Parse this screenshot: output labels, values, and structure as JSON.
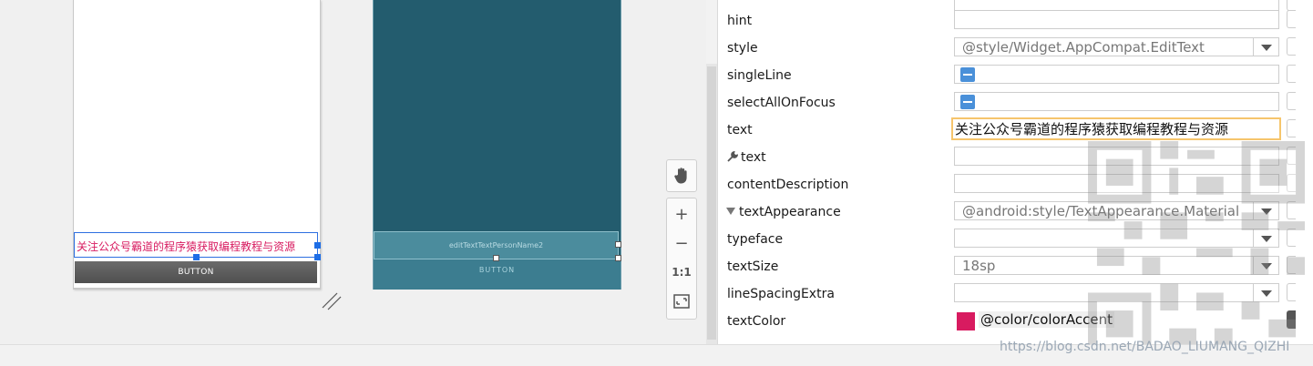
{
  "layout_preview": {
    "edit_text": "关注公众号霸道的程序猿获取编程教程与资源",
    "button_label": "BUTTON"
  },
  "blueprint_preview": {
    "edit_id": "editTextTextPersonName2",
    "button_label": "BUTTON"
  },
  "zoom_toolbar": {
    "pan_icon": "hand-icon",
    "zoom_in": "+",
    "zoom_out": "−",
    "actual_size": "1:1",
    "fit_icon": "fit-screen-icon"
  },
  "attributes": {
    "rows": [
      {
        "name": "hint",
        "value": "",
        "kind": "text"
      },
      {
        "name": "style",
        "value": "@style/Widget.AppCompat.EditText",
        "kind": "dropdown"
      },
      {
        "name": "singleLine",
        "value": "",
        "kind": "check"
      },
      {
        "name": "selectAllOnFocus",
        "value": "",
        "kind": "check"
      },
      {
        "name": "text",
        "value": "关注公众号霸道的程序猿获取编程教程与资源",
        "kind": "focus"
      },
      {
        "name": "text",
        "value": "",
        "kind": "tools",
        "icon": "wrench-icon"
      },
      {
        "name": "contentDescription",
        "value": "",
        "kind": "text"
      },
      {
        "name": "textAppearance",
        "value": "@android:style/TextAppearance.Material",
        "kind": "dropdown-expand"
      },
      {
        "name": "typeface",
        "value": "",
        "kind": "dropdown"
      },
      {
        "name": "textSize",
        "value": "18sp",
        "kind": "dropdown"
      },
      {
        "name": "lineSpacingExtra",
        "value": "",
        "kind": "dropdown"
      },
      {
        "name": "textColor",
        "value": "@color/colorAccent",
        "kind": "color",
        "swatch": "#d81b60"
      }
    ]
  },
  "watermark": "https://blog.csdn.net/BADAO_LIUMANG_QIZHI",
  "colors": {
    "accent": "#d81b60",
    "blueprint": "#235c6e",
    "selection": "#1e6ee6",
    "focus_border": "#f6c56c"
  }
}
